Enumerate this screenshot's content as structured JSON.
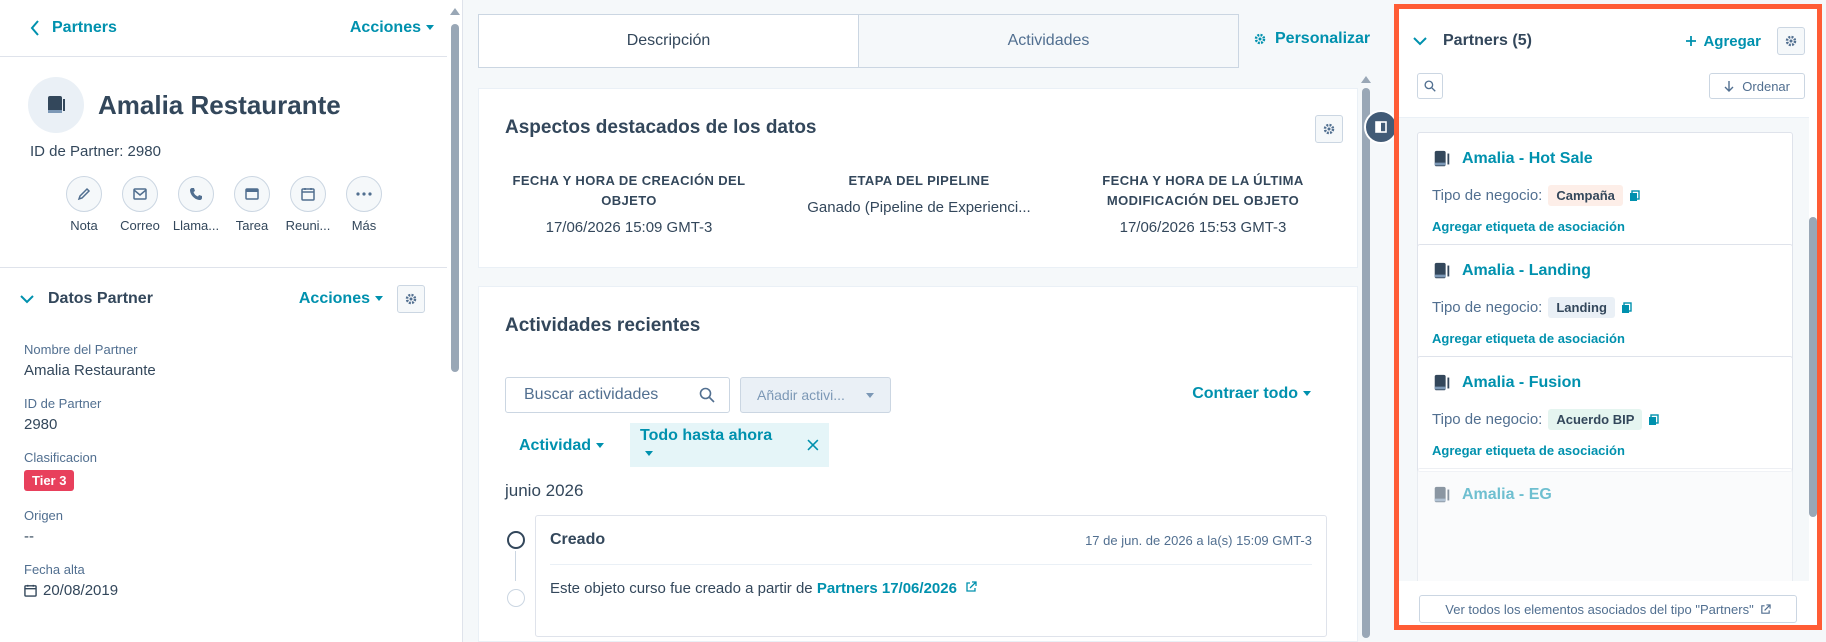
{
  "colors": {
    "accent": "#0091ae",
    "highlight_border": "#ff5c35",
    "tier_tag": "#e8405c",
    "text": "#33475b"
  },
  "left": {
    "back_label": "Partners",
    "actions_label": "Acciones",
    "record_title": "Amalia Restaurante",
    "record_id": "ID de Partner: 2980",
    "quick_actions": [
      {
        "label": "Nota",
        "icon": "pencil-icon"
      },
      {
        "label": "Correo",
        "icon": "email-icon"
      },
      {
        "label": "Llama...",
        "icon": "phone-icon"
      },
      {
        "label": "Tarea",
        "icon": "task-icon"
      },
      {
        "label": "Reuni...",
        "icon": "calendar-icon"
      },
      {
        "label": "Más",
        "icon": "more-icon"
      }
    ],
    "section": {
      "title": "Datos Partner",
      "actions_label": "Acciones",
      "fields": [
        {
          "label": "Nombre del Partner",
          "value": "Amalia Restaurante"
        },
        {
          "label": "ID de Partner",
          "value": "2980"
        },
        {
          "label": "Clasificacion",
          "value": "Tier 3"
        },
        {
          "label": "Origen",
          "value": "--"
        },
        {
          "label": "Fecha alta",
          "value": "20/08/2019"
        }
      ]
    }
  },
  "middle": {
    "tabs": [
      {
        "label": "Descripción"
      },
      {
        "label": "Actividades"
      }
    ],
    "personalize_label": "Personalizar",
    "highlights": {
      "title": "Aspectos destacados de los datos",
      "items": [
        {
          "key": "FECHA Y HORA DE CREACIÓN DEL OBJETO",
          "value": "17/06/2026 15:09 GMT-3"
        },
        {
          "key": "ETAPA DEL PIPELINE",
          "value": "Ganado (Pipeline de Experienci..."
        },
        {
          "key": "FECHA Y HORA DE LA ÚLTIMA MODIFICACIÓN DEL OBJETO",
          "value": "17/06/2026 15:53 GMT-3"
        }
      ]
    },
    "activities": {
      "title": "Actividades recientes",
      "search_placeholder": "Buscar actividades",
      "add_label": "Añadir activi...",
      "collapse_label": "Contraer todo",
      "filter_activity": "Actividad",
      "filter_time": "Todo hasta ahora",
      "month": "junio 2026",
      "event": {
        "title": "Creado",
        "time": "17 de jun. de 2026 a la(s) 15:09 GMT-3",
        "body_prefix": "Este objeto curso fue creado a partir de",
        "body_link": "Partners 17/06/2026"
      }
    }
  },
  "right": {
    "title": "Partners (5)",
    "add_label": "Agregar",
    "sort_label": "Ordenar",
    "items": [
      {
        "name": "Amalia - Hot Sale",
        "type_label": "Tipo de negocio:",
        "type": "Campaña",
        "type_color": "#fdeee8",
        "link": "Agregar etiqueta de asociación"
      },
      {
        "name": "Amalia - Landing",
        "type_label": "Tipo de negocio:",
        "type": "Landing",
        "type_color": "#eaf0f6",
        "link": "Agregar etiqueta de asociación"
      },
      {
        "name": "Amalia - Fusion",
        "type_label": "Tipo de negocio:",
        "type": "Acuerdo BIP",
        "type_color": "#e5f5f0",
        "link": "Agregar etiqueta de asociación"
      },
      {
        "name": "Amalia - EG"
      }
    ],
    "view_all_label": "Ver todos los elementos asociados del tipo \"Partners\""
  }
}
